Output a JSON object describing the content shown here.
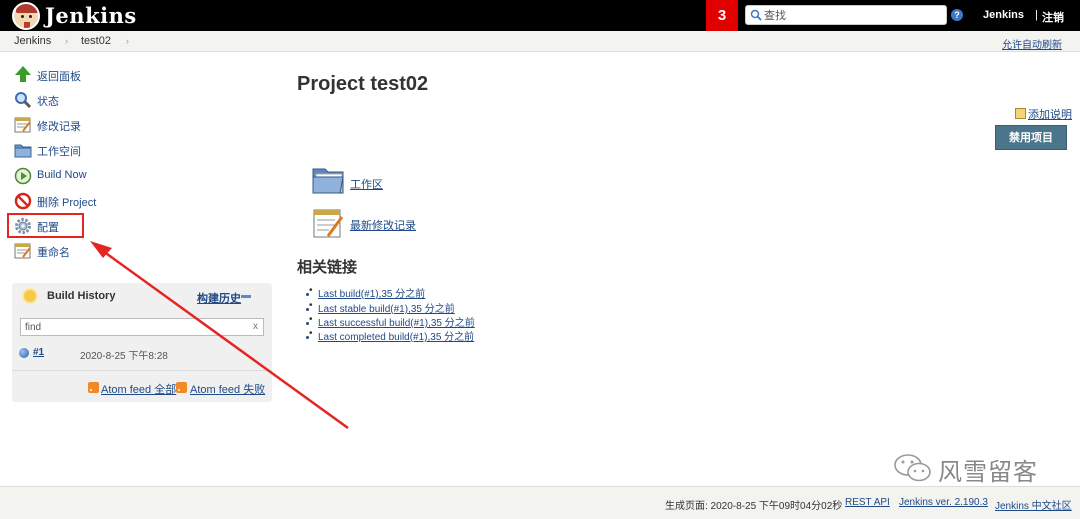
{
  "header": {
    "brand": "Jenkins",
    "notification_count": "3",
    "search": {
      "placeholder": "查找"
    },
    "help_label": "?",
    "user": "Jenkins",
    "separator": "|",
    "logout": "注销"
  },
  "breadcrumb": {
    "items": [
      "Jenkins",
      "test02"
    ],
    "auto_refresh": "允许自动刷新"
  },
  "sidebar": {
    "tasks": [
      {
        "label": "返回面板",
        "icon": "up-arrow-icon"
      },
      {
        "label": "状态",
        "icon": "search-icon"
      },
      {
        "label": "修改记录",
        "icon": "notepad-icon"
      },
      {
        "label": "工作空间",
        "icon": "folder-icon"
      },
      {
        "label": "Build Now",
        "icon": "clock-play-icon"
      },
      {
        "label": "删除 Project",
        "icon": "no-entry-icon"
      },
      {
        "label": "配置",
        "icon": "gear-icon"
      },
      {
        "label": "重命名",
        "icon": "notepad-icon"
      }
    ]
  },
  "build_history": {
    "title": "Build History",
    "trend_link": "构建历史",
    "filter_placeholder": "find",
    "clear": "x",
    "builds": [
      {
        "number": "#1",
        "date": "2020-8-25 下午8:28"
      }
    ],
    "feed_all": "Atom feed 全部",
    "feed_failed": "Atom feed 失败"
  },
  "main": {
    "title": "Project test02",
    "add_description": "添加说明",
    "disable_button": "禁用项目",
    "workspace_link": "工作区",
    "recent_changes_link": "最新修改记录",
    "related_title": "相关链接",
    "permalinks": [
      "Last build(#1),35 分之前",
      "Last stable build(#1),35 分之前",
      "Last successful build(#1),35 分之前",
      "Last completed build(#1),35 分之前"
    ]
  },
  "watermark": "风雪留客",
  "footer": {
    "generated": "生成页面: 2020-8-25 下午09时04分02秒",
    "rest_api": "REST API",
    "version": "Jenkins ver. 2.190.3",
    "community": "Jenkins 中文社区"
  },
  "colors": {
    "header_bg": "#000000",
    "badge": "#e00000",
    "link": "#204a87",
    "annotation_red": "#e52521",
    "disable_button_bg": "#4b758b"
  }
}
